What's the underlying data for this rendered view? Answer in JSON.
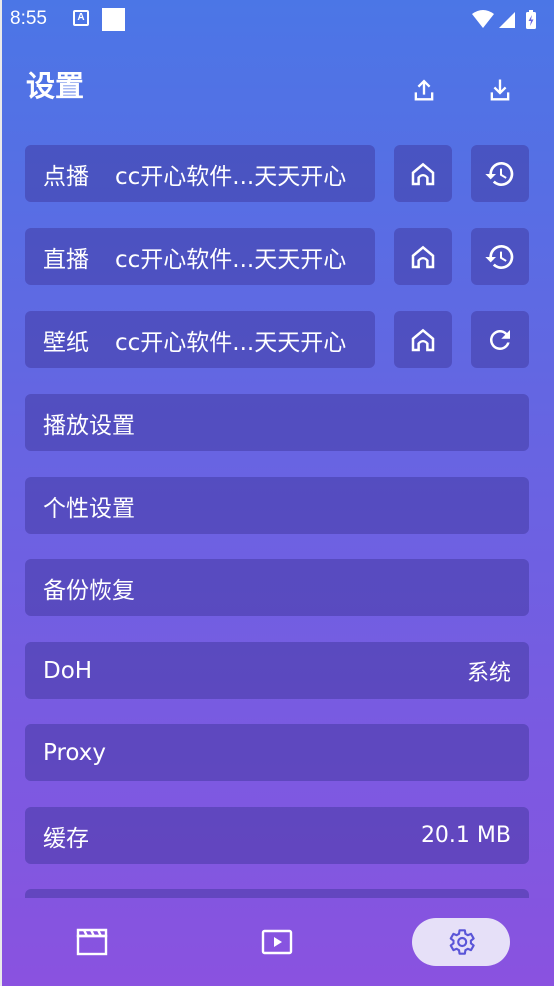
{
  "status_bar": {
    "time": "8:55",
    "notification_icons": [
      "text-a-icon",
      "square-icon"
    ],
    "system_icons": [
      "wifi-icon",
      "signal-icon",
      "battery-charging-icon"
    ]
  },
  "header": {
    "title": "设置",
    "actions": [
      {
        "name": "upload-icon"
      },
      {
        "name": "download-icon"
      }
    ]
  },
  "sources": [
    {
      "label": "点播",
      "site": "cc开心软件...天天开心",
      "actions": [
        "home-icon",
        "history-icon"
      ]
    },
    {
      "label": "直播",
      "site": "cc开心软件...天天开心",
      "actions": [
        "home-icon",
        "history-icon"
      ]
    },
    {
      "label": "壁纸",
      "site": "cc开心软件...天天开心",
      "actions": [
        "home-icon",
        "refresh-icon"
      ]
    }
  ],
  "settings": {
    "play": {
      "label": "播放设置"
    },
    "personal": {
      "label": "个性设置"
    },
    "backup": {
      "label": "备份恢复"
    },
    "doh": {
      "label": "DoH",
      "value": "系统"
    },
    "proxy": {
      "label": "Proxy"
    },
    "cache": {
      "label": "缓存",
      "value": "20.1 MB"
    }
  },
  "bottom_nav": {
    "items": [
      {
        "name": "video-icon"
      },
      {
        "name": "live-icon"
      },
      {
        "name": "settings-icon",
        "active": true
      }
    ]
  },
  "colors": {
    "gradient_top": "#4b76e6",
    "gradient_bottom": "#8a54e0",
    "row_bg": "rgba(60,50,150,0.45)",
    "active_nav_bg": "#e6e0f8",
    "active_nav_icon": "#5a55d8"
  }
}
